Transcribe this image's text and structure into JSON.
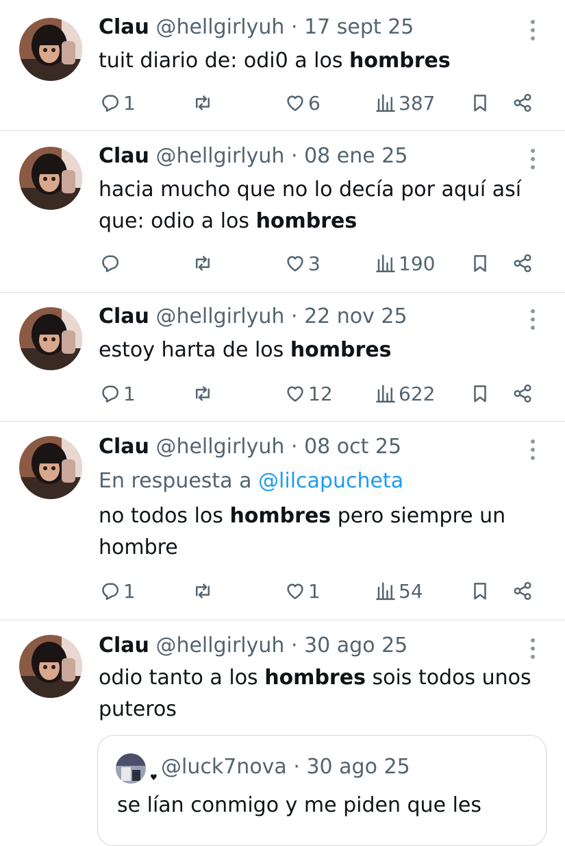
{
  "tweets": [
    {
      "name": "Clau",
      "handle": "@hellgirlyuh",
      "sep": "·",
      "date": "17 sept 25",
      "line1_pre": "tuit diario de: odi0 a los ",
      "line1_bold": "hombres",
      "replies": "1",
      "likes": "6",
      "views": "387"
    },
    {
      "name": "Clau",
      "handle": "@hellgirlyuh",
      "sep": "·",
      "date": "08 ene 25",
      "line1": "hacia mucho que no lo decía por aquí así",
      "line2_pre": "que: odio a los ",
      "line2_bold": "hombres",
      "replies": "",
      "likes": "3",
      "views": "190"
    },
    {
      "name": "Clau",
      "handle": "@hellgirlyuh",
      "sep": "·",
      "date": "22 nov 25",
      "line1_pre": "estoy harta de los ",
      "line1_bold": "hombres",
      "replies": "1",
      "likes": "12",
      "views": "622"
    },
    {
      "name": "Clau",
      "handle": "@hellgirlyuh",
      "sep": "·",
      "date": "08 oct 25",
      "reply_prefix": "En respuesta a",
      "reply_to": "@lilcapucheta",
      "line1_pre": "no todos los ",
      "line1_bold": "hombres",
      "line1_post": " pero siempre un",
      "line2": "hombre",
      "replies": "1",
      "likes": "1",
      "views": "54"
    },
    {
      "name": "Clau",
      "handle": "@hellgirlyuh",
      "sep": "·",
      "date": "30 ago 25",
      "line1_pre": "odio tanto a los ",
      "line1_bold": "hombres",
      "line1_post": " sois todos unos",
      "line2": "puteros",
      "quote": {
        "handle": "@luck7nova",
        "sep": "·",
        "date": "30 ago 25",
        "text": "se lían conmigo y me piden que les"
      }
    }
  ],
  "colors": {
    "text": "#0f1419",
    "muted": "#536471",
    "link": "#1d9bf0",
    "divider": "#dcdfe3"
  },
  "icons": [
    "reply-icon",
    "retweet-icon",
    "like-icon",
    "views-icon",
    "bookmark-icon",
    "share-icon",
    "more-icon"
  ]
}
